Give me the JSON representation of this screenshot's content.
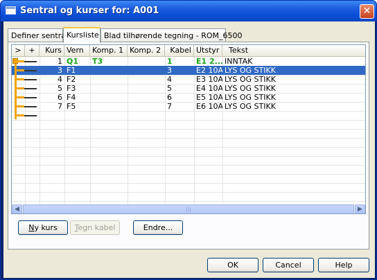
{
  "window": {
    "title": "Sentral og kurser for: A001"
  },
  "tabs": [
    {
      "label": "Definer sentral",
      "active": false
    },
    {
      "label": "Kursliste",
      "active": true
    },
    {
      "label": "Blad tilhørende tegning - ROM_6500",
      "active": false
    }
  ],
  "grid": {
    "columns": [
      ">",
      "+",
      "Kurs",
      "Vern",
      "Komp. 1",
      "Komp. 2",
      "Kabel",
      "Utstyr",
      "Tekst"
    ],
    "rows": [
      {
        "kurs": "1",
        "vern": "Q1",
        "komp1": "T3",
        "komp2": "",
        "kabel": "1",
        "utstyr": "E1 2...",
        "tekst": "INNTAK",
        "selected": false,
        "highlight": true
      },
      {
        "kurs": "3",
        "vern": "F1",
        "komp1": "",
        "komp2": "",
        "kabel": "3",
        "utstyr": "E2 10A",
        "tekst": "LYS OG STIKK",
        "selected": true,
        "highlight": false
      },
      {
        "kurs": "4",
        "vern": "F2",
        "komp1": "",
        "komp2": "",
        "kabel": "4",
        "utstyr": "E3 10A",
        "tekst": "LYS OG STIKK",
        "selected": false,
        "highlight": false
      },
      {
        "kurs": "5",
        "vern": "F3",
        "komp1": "",
        "komp2": "",
        "kabel": "5",
        "utstyr": "E4 10A",
        "tekst": "LYS OG STIKK",
        "selected": false,
        "highlight": false
      },
      {
        "kurs": "6",
        "vern": "F4",
        "komp1": "",
        "komp2": "",
        "kabel": "6",
        "utstyr": "E5 10A",
        "tekst": "LYS OG STIKK",
        "selected": false,
        "highlight": false
      },
      {
        "kurs": "7",
        "vern": "F5",
        "komp1": "",
        "komp2": "",
        "kabel": "7",
        "utstyr": "E6 10A",
        "tekst": "LYS OG STIKK",
        "selected": false,
        "highlight": false
      }
    ]
  },
  "panel_buttons": {
    "ny_kurs_u": "N",
    "ny_kurs_rest": "y kurs",
    "tegn_kabel_u": "T",
    "tegn_kabel_rest": "egn kabel",
    "endre": "Endre..."
  },
  "footer_buttons": {
    "ok": "OK",
    "cancel": "Cancel",
    "help": "Help"
  },
  "colors": {
    "selection": "#316ac5",
    "highlight_text": "#1aa51a",
    "tree": "#f3a400"
  }
}
